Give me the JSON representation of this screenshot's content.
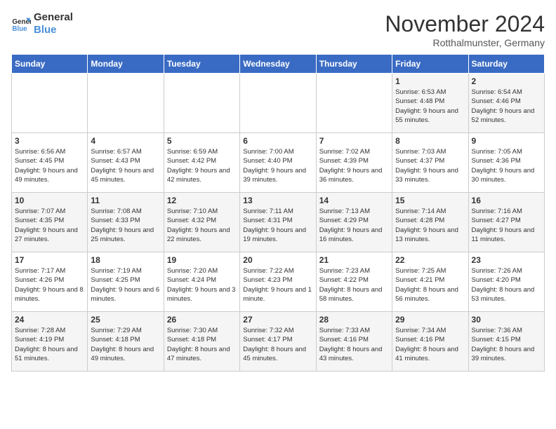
{
  "header": {
    "logo_line1": "General",
    "logo_line2": "Blue",
    "month_year": "November 2024",
    "location": "Rotthalmunster, Germany"
  },
  "days_of_week": [
    "Sunday",
    "Monday",
    "Tuesday",
    "Wednesday",
    "Thursday",
    "Friday",
    "Saturday"
  ],
  "weeks": [
    [
      {
        "day": "",
        "detail": ""
      },
      {
        "day": "",
        "detail": ""
      },
      {
        "day": "",
        "detail": ""
      },
      {
        "day": "",
        "detail": ""
      },
      {
        "day": "",
        "detail": ""
      },
      {
        "day": "1",
        "detail": "Sunrise: 6:53 AM\nSunset: 4:48 PM\nDaylight: 9 hours and 55 minutes."
      },
      {
        "day": "2",
        "detail": "Sunrise: 6:54 AM\nSunset: 4:46 PM\nDaylight: 9 hours and 52 minutes."
      }
    ],
    [
      {
        "day": "3",
        "detail": "Sunrise: 6:56 AM\nSunset: 4:45 PM\nDaylight: 9 hours and 49 minutes."
      },
      {
        "day": "4",
        "detail": "Sunrise: 6:57 AM\nSunset: 4:43 PM\nDaylight: 9 hours and 45 minutes."
      },
      {
        "day": "5",
        "detail": "Sunrise: 6:59 AM\nSunset: 4:42 PM\nDaylight: 9 hours and 42 minutes."
      },
      {
        "day": "6",
        "detail": "Sunrise: 7:00 AM\nSunset: 4:40 PM\nDaylight: 9 hours and 39 minutes."
      },
      {
        "day": "7",
        "detail": "Sunrise: 7:02 AM\nSunset: 4:39 PM\nDaylight: 9 hours and 36 minutes."
      },
      {
        "day": "8",
        "detail": "Sunrise: 7:03 AM\nSunset: 4:37 PM\nDaylight: 9 hours and 33 minutes."
      },
      {
        "day": "9",
        "detail": "Sunrise: 7:05 AM\nSunset: 4:36 PM\nDaylight: 9 hours and 30 minutes."
      }
    ],
    [
      {
        "day": "10",
        "detail": "Sunrise: 7:07 AM\nSunset: 4:35 PM\nDaylight: 9 hours and 27 minutes."
      },
      {
        "day": "11",
        "detail": "Sunrise: 7:08 AM\nSunset: 4:33 PM\nDaylight: 9 hours and 25 minutes."
      },
      {
        "day": "12",
        "detail": "Sunrise: 7:10 AM\nSunset: 4:32 PM\nDaylight: 9 hours and 22 minutes."
      },
      {
        "day": "13",
        "detail": "Sunrise: 7:11 AM\nSunset: 4:31 PM\nDaylight: 9 hours and 19 minutes."
      },
      {
        "day": "14",
        "detail": "Sunrise: 7:13 AM\nSunset: 4:29 PM\nDaylight: 9 hours and 16 minutes."
      },
      {
        "day": "15",
        "detail": "Sunrise: 7:14 AM\nSunset: 4:28 PM\nDaylight: 9 hours and 13 minutes."
      },
      {
        "day": "16",
        "detail": "Sunrise: 7:16 AM\nSunset: 4:27 PM\nDaylight: 9 hours and 11 minutes."
      }
    ],
    [
      {
        "day": "17",
        "detail": "Sunrise: 7:17 AM\nSunset: 4:26 PM\nDaylight: 9 hours and 8 minutes."
      },
      {
        "day": "18",
        "detail": "Sunrise: 7:19 AM\nSunset: 4:25 PM\nDaylight: 9 hours and 6 minutes."
      },
      {
        "day": "19",
        "detail": "Sunrise: 7:20 AM\nSunset: 4:24 PM\nDaylight: 9 hours and 3 minutes."
      },
      {
        "day": "20",
        "detail": "Sunrise: 7:22 AM\nSunset: 4:23 PM\nDaylight: 9 hours and 1 minute."
      },
      {
        "day": "21",
        "detail": "Sunrise: 7:23 AM\nSunset: 4:22 PM\nDaylight: 8 hours and 58 minutes."
      },
      {
        "day": "22",
        "detail": "Sunrise: 7:25 AM\nSunset: 4:21 PM\nDaylight: 8 hours and 56 minutes."
      },
      {
        "day": "23",
        "detail": "Sunrise: 7:26 AM\nSunset: 4:20 PM\nDaylight: 8 hours and 53 minutes."
      }
    ],
    [
      {
        "day": "24",
        "detail": "Sunrise: 7:28 AM\nSunset: 4:19 PM\nDaylight: 8 hours and 51 minutes."
      },
      {
        "day": "25",
        "detail": "Sunrise: 7:29 AM\nSunset: 4:18 PM\nDaylight: 8 hours and 49 minutes."
      },
      {
        "day": "26",
        "detail": "Sunrise: 7:30 AM\nSunset: 4:18 PM\nDaylight: 8 hours and 47 minutes."
      },
      {
        "day": "27",
        "detail": "Sunrise: 7:32 AM\nSunset: 4:17 PM\nDaylight: 8 hours and 45 minutes."
      },
      {
        "day": "28",
        "detail": "Sunrise: 7:33 AM\nSunset: 4:16 PM\nDaylight: 8 hours and 43 minutes."
      },
      {
        "day": "29",
        "detail": "Sunrise: 7:34 AM\nSunset: 4:16 PM\nDaylight: 8 hours and 41 minutes."
      },
      {
        "day": "30",
        "detail": "Sunrise: 7:36 AM\nSunset: 4:15 PM\nDaylight: 8 hours and 39 minutes."
      }
    ]
  ]
}
